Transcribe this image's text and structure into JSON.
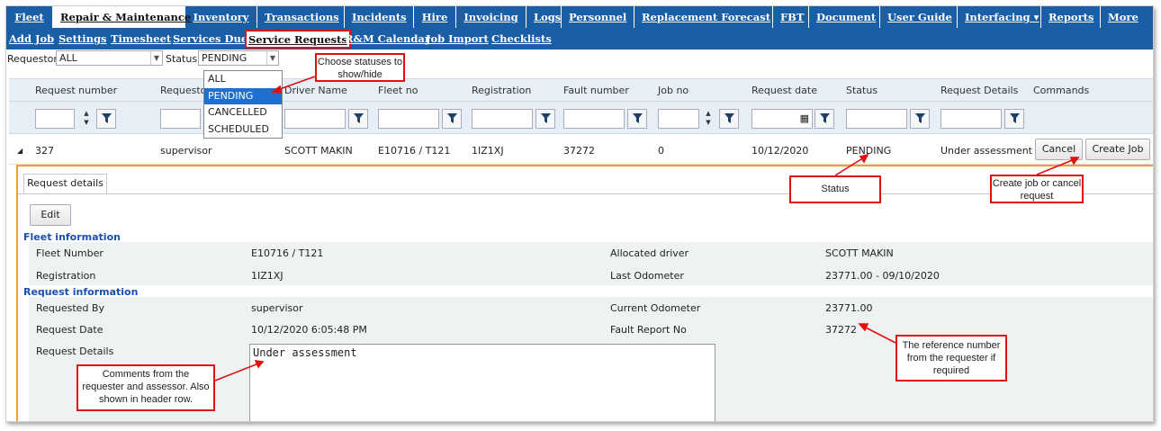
{
  "top_nav": [
    "Fleet",
    "Repair & Maintenance",
    "Inventory",
    "Transactions",
    "Incidents",
    "Hire",
    "Invoicing",
    "Logs",
    "Personnel",
    "Replacement Forecast",
    "FBT",
    "Document",
    "User Guide",
    "Interfacing ▾",
    "Reports",
    "More"
  ],
  "sub_nav": [
    "Add Job",
    "Settings",
    "Timesheet",
    "Services Due",
    "Service Requests",
    "R&M Calendar",
    "Job Import",
    "Checklists"
  ],
  "filters": {
    "requestor_label": "Requestor",
    "requestor_value": "ALL",
    "status_label": "Status",
    "status_value": "PENDING"
  },
  "status_options": [
    "ALL",
    "PENDING",
    "CANCELLED",
    "SCHEDULED"
  ],
  "columns": [
    "Request number",
    "Requestor",
    "Driver Name",
    "Fleet no",
    "Registration",
    "Fault number",
    "Job no",
    "Request date",
    "Status",
    "Request Details",
    "Commands"
  ],
  "row": {
    "request_number": "327",
    "requestor": "supervisor",
    "driver": "SCOTT MAKIN",
    "fleet_no": "E10716 / T121",
    "registration": "1IZ1XJ",
    "fault_number": "37272",
    "job_no": "0",
    "request_date": "10/12/2020",
    "status": "PENDING",
    "details": "Under assessment",
    "cancel": "Cancel",
    "create_job": "Create Job"
  },
  "detail": {
    "tab": "Request details",
    "edit": "Edit",
    "fleet_section": "Fleet information",
    "request_section": "Request information",
    "fleet_number_label": "Fleet Number",
    "fleet_number": "E10716 / T121",
    "registration_label": "Registration",
    "registration": "1IZ1XJ",
    "allocated_driver_label": "Allocated driver",
    "allocated_driver": "SCOTT MAKIN",
    "last_odometer_label": "Last Odometer",
    "last_odometer": "23771.00 - 09/10/2020",
    "requested_by_label": "Requested By",
    "requested_by": "supervisor",
    "request_date_label": "Request Date",
    "request_date": "10/12/2020 6:05:48 PM",
    "request_details_label": "Request Details",
    "request_details": "Under assessment",
    "current_odometer_label": "Current Odometer",
    "current_odometer": "23771.00",
    "fault_report_label": "Fault Report No",
    "fault_report": "37272"
  },
  "callouts": {
    "statuses": "Choose statuses to show/hide",
    "status": "Status",
    "create": "Create job or cancel request",
    "comments": "Comments from the requester and assessor. Also shown in header row.",
    "reference": "The reference number from the requester if required"
  },
  "colors": {
    "nav": "#1a5ea6",
    "accent_red": "#e01010",
    "section_blue": "#1a4fb0",
    "orange": "#f0a030"
  }
}
